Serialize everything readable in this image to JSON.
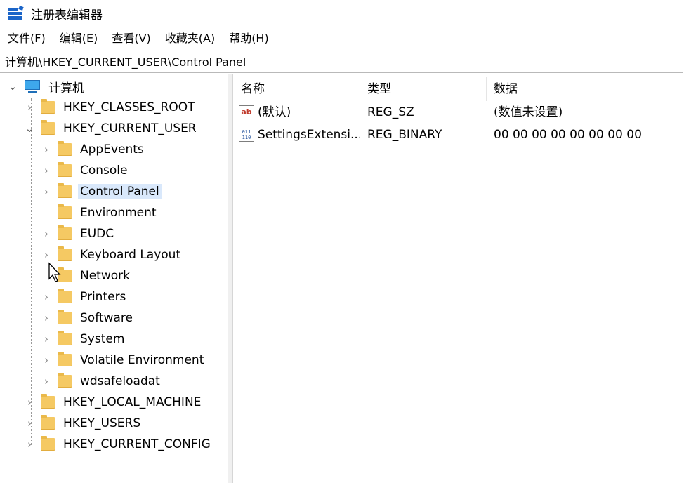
{
  "window": {
    "title": "注册表编辑器",
    "icon": "registry-editor-icon"
  },
  "menu": [
    "文件(F)",
    "编辑(E)",
    "查看(V)",
    "收藏夹(A)",
    "帮助(H)"
  ],
  "address": "计算机\\HKEY_CURRENT_USER\\Control Panel",
  "tree": {
    "root": "计算机",
    "nodes": [
      {
        "label": "HKEY_CLASSES_ROOT",
        "level": 1,
        "expander": "collapsed"
      },
      {
        "label": "HKEY_CURRENT_USER",
        "level": 1,
        "expander": "expanded"
      },
      {
        "label": "AppEvents",
        "level": 2,
        "expander": "collapsed"
      },
      {
        "label": "Console",
        "level": 2,
        "expander": "collapsed"
      },
      {
        "label": "Control Panel",
        "level": 2,
        "expander": "collapsed",
        "selected": true
      },
      {
        "label": "Environment",
        "level": 2,
        "expander": "none"
      },
      {
        "label": "EUDC",
        "level": 2,
        "expander": "collapsed"
      },
      {
        "label": "Keyboard Layout",
        "level": 2,
        "expander": "collapsed"
      },
      {
        "label": "Network",
        "level": 2,
        "expander": "none"
      },
      {
        "label": "Printers",
        "level": 2,
        "expander": "collapsed"
      },
      {
        "label": "Software",
        "level": 2,
        "expander": "collapsed"
      },
      {
        "label": "System",
        "level": 2,
        "expander": "collapsed"
      },
      {
        "label": "Volatile Environment",
        "level": 2,
        "expander": "collapsed"
      },
      {
        "label": "wdsafeloadat",
        "level": 2,
        "expander": "collapsed"
      },
      {
        "label": "HKEY_LOCAL_MACHINE",
        "level": 1,
        "expander": "collapsed"
      },
      {
        "label": "HKEY_USERS",
        "level": 1,
        "expander": "collapsed"
      },
      {
        "label": "HKEY_CURRENT_CONFIG",
        "level": 1,
        "expander": "collapsed"
      }
    ]
  },
  "list": {
    "columns": [
      "名称",
      "类型",
      "数据"
    ],
    "rows": [
      {
        "name": "(默认)",
        "type": "REG_SZ",
        "data": "(数值未设置)",
        "icon": "string-value-icon"
      },
      {
        "name": "SettingsExtensi...",
        "type": "REG_BINARY",
        "data": "00 00 00 00 00 00 00 00",
        "icon": "binary-value-icon"
      }
    ]
  },
  "colors": {
    "selection": "#d9e8fb",
    "folder": "#f5c963",
    "accent": "#1a64c8"
  }
}
